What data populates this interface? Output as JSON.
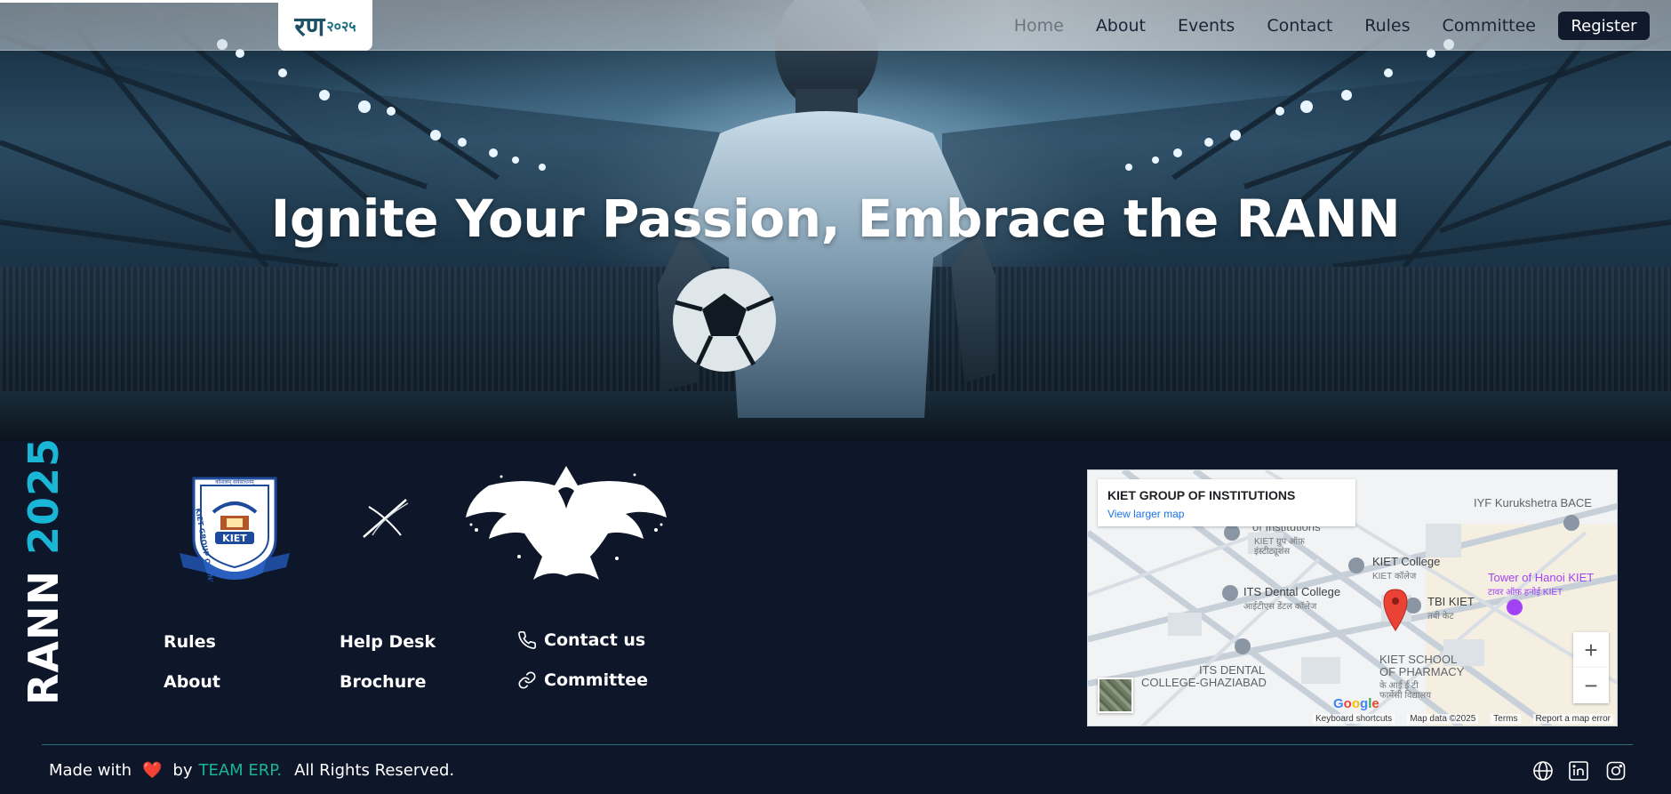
{
  "navbar": {
    "logo_main": "रण",
    "logo_year": "२०२५",
    "links": [
      "Home",
      "About",
      "Events",
      "Contact",
      "Rules",
      "Committee"
    ],
    "active_link": "Home",
    "register_label": "Register"
  },
  "hero": {
    "title": "Ignite Your Passion, Embrace the RANN"
  },
  "footer": {
    "vertical_brand_1": "RANN",
    "vertical_brand_2": "2025",
    "kiet_logo_text": "KIET",
    "kiet_ring_text": "KIET GROUP OF INSTITUTIONS",
    "kiet_motto": "कौशलम् सर्वसाधनम्",
    "links": {
      "rules": "Rules",
      "about": "About",
      "help_desk": "Help Desk",
      "brochure": "Brochure",
      "contact_us": "Contact us",
      "committee": "Committee"
    },
    "map": {
      "card_title": "KIET GROUP OF INSTITUTIONS",
      "card_link": "View larger map",
      "labels": {
        "iyf": "IYF Kurukshetra BACE",
        "of_institutions": "of Institutions",
        "of_institutions_sub": "KIET ग्रुप ऑफ़",
        "of_institutions_sub2": "इंस्टीट्यूशंस",
        "kiet_college": "KIET College",
        "kiet_college_sub": "KIET कॉलेज",
        "its_dental": "ITS Dental College",
        "its_dental_sub": "आईटीएस डेंटल कॉलेज",
        "tbi_kiet": "TBI KIET",
        "tbi_kiet_sub": "तबी केट",
        "tower": "Tower of Hanoi KIET",
        "tower_sub": "टावर ऑफ़ हनोई KIET",
        "its_dental_gz_1": "ITS DENTAL",
        "its_dental_gz_2": "COLLEGE-GHAZIABAD",
        "pharmacy_1": "KIET SCHOOL",
        "pharmacy_2": "OF PHARMACY",
        "pharmacy_3": "के आई ई टी",
        "pharmacy_4": "फार्मेसी विद्यालय"
      },
      "google": "Google",
      "zoom_in": "+",
      "zoom_out": "−",
      "footer_items": [
        "Keyboard shortcuts",
        "Map data ©2025",
        "Terms",
        "Report a map error"
      ]
    },
    "copyright": {
      "made_with": "Made with",
      "heart": "❤️",
      "by": "by",
      "team": "TEAM ERP.",
      "rights": "All Rights Reserved."
    },
    "colors": {
      "background": "#0e1629",
      "accent_cyan": "#1ab6d6",
      "team_green": "#1ab394",
      "divider": "#2c6d80"
    },
    "social_icons": [
      "globe-icon",
      "linkedin-icon",
      "instagram-icon"
    ]
  }
}
